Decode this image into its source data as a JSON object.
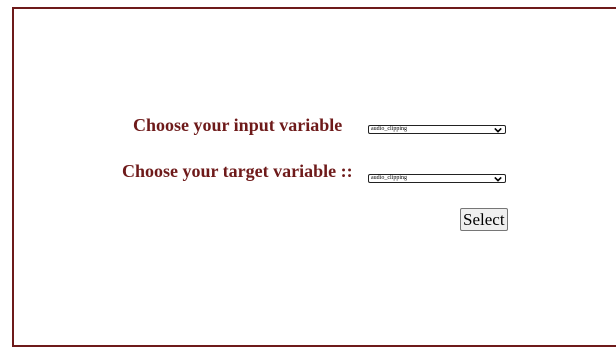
{
  "form": {
    "input_label": "Choose your input variable",
    "target_label": "Choose your target variable ::",
    "input_select": {
      "selected": "audio_clipping"
    },
    "target_select": {
      "selected": "audio_clipping"
    },
    "submit_label": "Select"
  },
  "colors": {
    "label_text": "#6e1a1a",
    "frame_border": "#6e1a1a"
  },
  "icons": {
    "select_caret": "chevron-down-icon"
  }
}
